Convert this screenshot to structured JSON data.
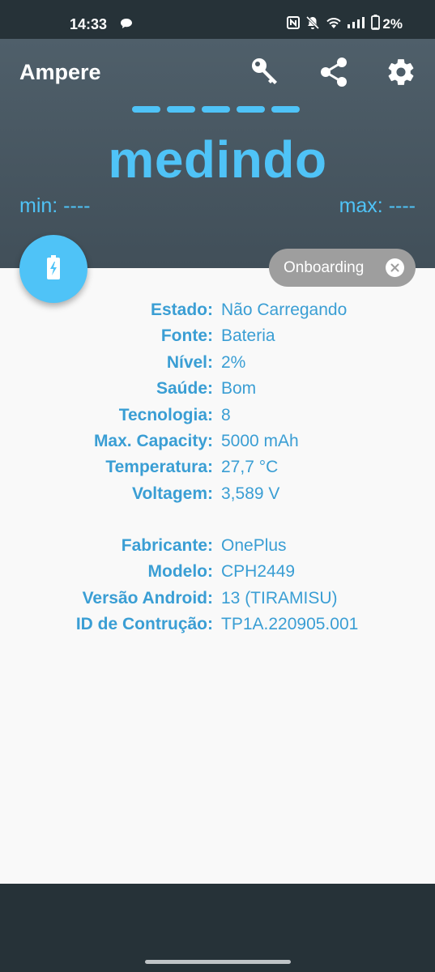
{
  "status_bar": {
    "time": "14:33",
    "battery_text": "2%",
    "icons": [
      "message-bubble-icon",
      "nfc-icon",
      "bell-off-icon",
      "wifi-icon",
      "signal-icon",
      "battery-icon"
    ]
  },
  "app": {
    "title": "Ampere",
    "actions": [
      "key-icon",
      "share-icon",
      "gear-icon"
    ]
  },
  "meter": {
    "reading": "medindo",
    "min_label": "min: ----",
    "max_label": "max: ----"
  },
  "onboarding_chip": {
    "label": "Onboarding"
  },
  "battery_info": [
    {
      "key": "Estado:",
      "value": "Não Carregando"
    },
    {
      "key": "Fonte:",
      "value": "Bateria"
    },
    {
      "key": "Nível:",
      "value": "2%"
    },
    {
      "key": "Saúde:",
      "value": "Bom"
    },
    {
      "key": "Tecnologia:",
      "value": "8"
    },
    {
      "key": "Max. Capacity:",
      "value": "5000 mAh"
    },
    {
      "key": "Temperatura:",
      "value": "27,7 °C"
    },
    {
      "key": "Voltagem:",
      "value": "3,589 V"
    }
  ],
  "device_info": [
    {
      "key": "Fabricante:",
      "value": "OnePlus"
    },
    {
      "key": "Modelo:",
      "value": "CPH2449"
    },
    {
      "key": "Versão Android:",
      "value": "13 (TIRAMISU)"
    },
    {
      "key": "ID de Contrução:",
      "value": "TP1A.220905.001"
    }
  ],
  "colors": {
    "accent": "#4fc3f7",
    "text_accent": "#3a9ed4",
    "header_bg": "#4a5862",
    "system_bar": "#263238",
    "chip_bg": "#9e9e9e"
  }
}
